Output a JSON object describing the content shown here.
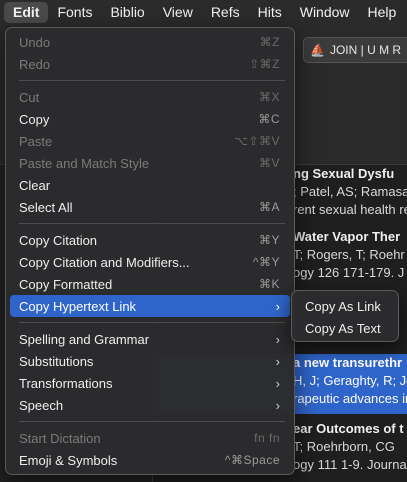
{
  "menubar": {
    "items": [
      "Edit",
      "Fonts",
      "Biblio",
      "View",
      "Refs",
      "Hits",
      "Window",
      "Help"
    ]
  },
  "toolbar": {
    "join_label": "JOIN | U M R"
  },
  "references": [
    {
      "title": "ng Sexual Dysfu",
      "authors": "; Patel, AS; Ramasa",
      "journal": "rent sexual health re"
    },
    {
      "title": "Water Vapor Ther",
      "authors": "T; Rogers, T; Roehr",
      "journal": "ogy 126 171-179. J"
    },
    {
      "title": "",
      "authors": "",
      "journal": ""
    },
    {
      "title": "a new transurethr",
      "authors": "H, J; Geraghty, R; Jo",
      "journal": "rapeutic advances in"
    },
    {
      "title": "ear Outcomes of t",
      "authors": "T; Roehrborn, CG",
      "journal": "ogy 111 1-9. Journa"
    }
  ],
  "edit_menu": {
    "items": [
      {
        "label": "Undo",
        "shortcut": "⌘Z"
      },
      {
        "label": "Redo",
        "shortcut": "⇧⌘Z"
      },
      {
        "label": "Cut",
        "shortcut": "⌘X"
      },
      {
        "label": "Copy",
        "shortcut": "⌘C"
      },
      {
        "label": "Paste",
        "shortcut": "⌥⇧⌘V"
      },
      {
        "label": "Paste and Match Style",
        "shortcut": "⌘V"
      },
      {
        "label": "Clear",
        "shortcut": ""
      },
      {
        "label": "Select All",
        "shortcut": "⌘A"
      },
      {
        "label": "Copy Citation",
        "shortcut": "⌘Y"
      },
      {
        "label": "Copy Citation and Modifiers...",
        "shortcut": "^⌘Y"
      },
      {
        "label": "Copy Formatted",
        "shortcut": "⌘K"
      },
      {
        "label": "Copy Hypertext Link",
        "shortcut": ""
      },
      {
        "label": "Spelling and Grammar",
        "shortcut": ""
      },
      {
        "label": "Substitutions",
        "shortcut": ""
      },
      {
        "label": "Transformations",
        "shortcut": ""
      },
      {
        "label": "Speech",
        "shortcut": ""
      },
      {
        "label": "Start Dictation",
        "shortcut": "fn fn"
      },
      {
        "label": "Emoji & Symbols",
        "shortcut": "^⌘Space"
      }
    ]
  },
  "submenu": {
    "items": [
      "Copy As Link",
      "Copy As Text"
    ]
  },
  "colors": {
    "highlight": "#2f65ca",
    "menu_background": "#2c2c2e"
  }
}
